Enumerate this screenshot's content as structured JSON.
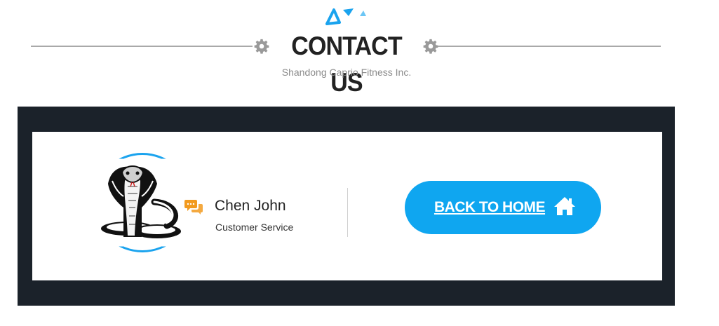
{
  "header": {
    "title": "CONTACT US",
    "subtitle": "Shandong Caprio Fitness Inc."
  },
  "contact": {
    "name": "Chen John",
    "role": "Customer Service",
    "avatar_icon": "cobra-logo-icon",
    "chat_icon": "chat-bubbles-icon"
  },
  "actions": {
    "back_home_label": "BACK TO HOME",
    "home_icon": "house-icon"
  },
  "colors": {
    "accent_blue": "#0fa6f0",
    "band_dark": "#1b222a",
    "chat_orange": "#f29a1e",
    "title_dark": "#222222"
  }
}
